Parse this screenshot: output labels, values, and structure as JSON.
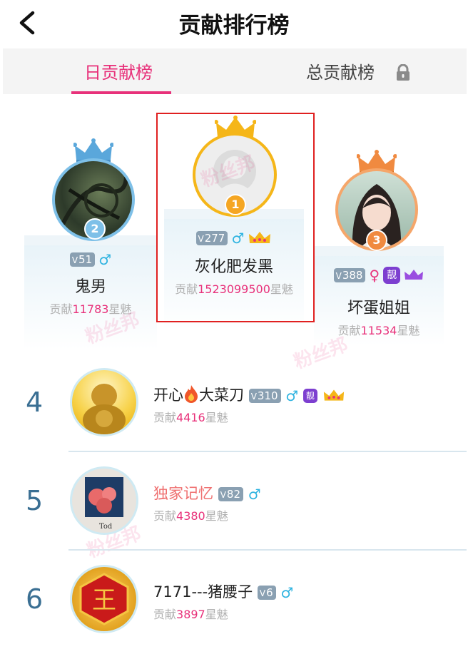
{
  "header": {
    "title": "贡献排行榜"
  },
  "tabs": [
    {
      "label": "日贡献榜",
      "active": true
    },
    {
      "label": "总贡献榜",
      "active": false,
      "locked": true
    }
  ],
  "contribution_prefix": "贡献",
  "contribution_unit": "星魅",
  "top3": [
    {
      "rank": "1",
      "name": "灰化肥发黑",
      "level": "277",
      "gender": "♂",
      "contribution": "1523099500"
    },
    {
      "rank": "2",
      "name": "鬼男",
      "level": "51",
      "gender": "♂",
      "contribution": "11783"
    },
    {
      "rank": "3",
      "name": "坏蛋姐姐",
      "level": "388",
      "gender": "♀",
      "badge": "靓",
      "contribution": "11534"
    }
  ],
  "list": [
    {
      "rank": "4",
      "name_parts": [
        "开心",
        "大菜刀"
      ],
      "level": "310",
      "gender": "♂",
      "badge": "靓",
      "contribution": "4416"
    },
    {
      "rank": "5",
      "name": "独家记忆",
      "level": "82",
      "gender": "♂",
      "contribution": "4380"
    },
    {
      "rank": "6",
      "name": "7171---猪腰子",
      "level": "6",
      "gender": "♂",
      "contribution": "3897"
    }
  ],
  "watermark": "粉丝邦",
  "avatar_extra": {
    "rank6_glyph": "王",
    "rank5_caption": "Tod"
  },
  "colors": {
    "accent": "#e8317a",
    "male": "#2eb3e0",
    "gold": "#f5b619",
    "silver_blue": "#5aa7db",
    "bronze": "#f08a40"
  }
}
